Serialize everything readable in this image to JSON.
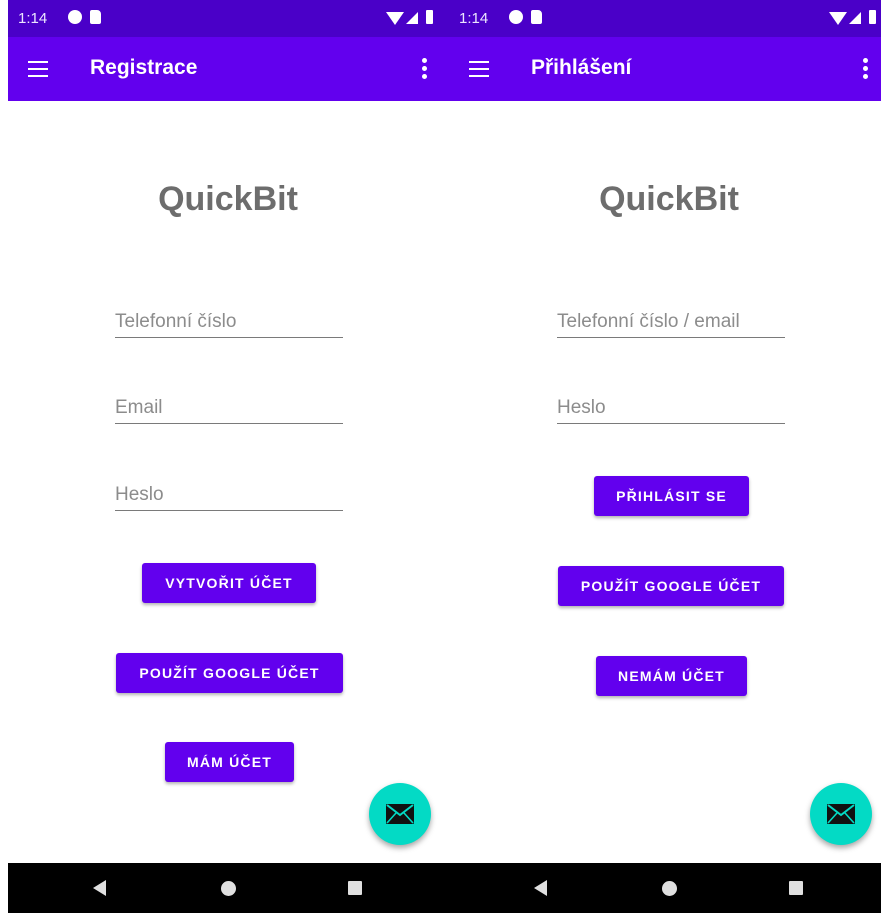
{
  "status_bar": {
    "time": "1:14"
  },
  "left_screen": {
    "title": "Registrace",
    "logo": "QuickBit",
    "fields": {
      "phone_placeholder": "Telefonní číslo",
      "email_placeholder": "Email",
      "password_placeholder": "Heslo"
    },
    "buttons": {
      "create_account": "VYTVOŘIT ÚČET",
      "use_google": "POUŽÍT GOOGLE ÚČET",
      "have_account": "MÁM ÚČET"
    }
  },
  "right_screen": {
    "title": "Přihlášení",
    "logo": "QuickBit",
    "fields": {
      "login_placeholder": "Telefonní číslo / email",
      "password_placeholder": "Heslo"
    },
    "buttons": {
      "sign_in": "PŘIHLÁSIT SE",
      "use_google": "POUŽÍT GOOGLE ÚČET",
      "no_account": "NEMÁM ÚČET"
    }
  },
  "icons": {
    "menu": "menu-icon",
    "more": "more-vert-icon",
    "fab": "email-icon",
    "nav_back": "back-icon",
    "nav_home": "home-icon",
    "nav_recents": "recents-icon"
  },
  "colors": {
    "status_bar": "#4a00c8",
    "app_bar": "#6200ee",
    "button": "#6200ee",
    "fab": "#03dac5",
    "logo_text": "#6d6d6d"
  }
}
